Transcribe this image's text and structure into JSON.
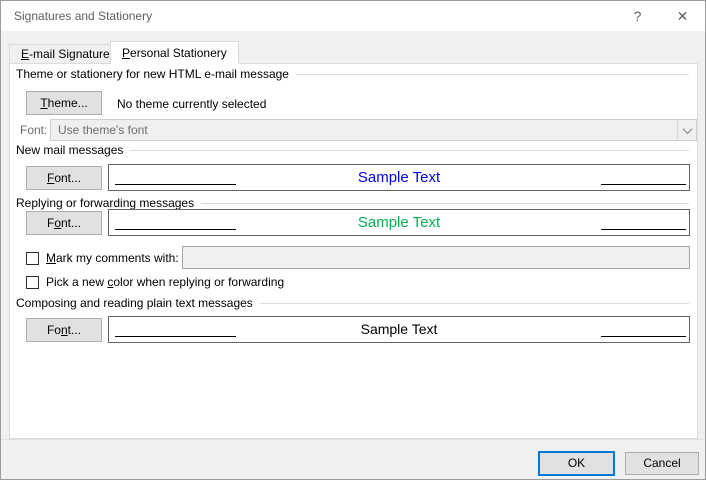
{
  "colors": {
    "accent": "#0078d7",
    "sample_new_mail": "#0000ff",
    "sample_reply_forward": "#00b050",
    "sample_plain_text": "#000000"
  },
  "window": {
    "title": "Signatures and Stationery",
    "help_glyph": "?",
    "close_glyph": "✕"
  },
  "tabs": {
    "email_signature": {
      "key": "E",
      "rest": "-mail Signature"
    },
    "personal_stationery": {
      "key": "P",
      "rest": "ersonal Stationery"
    }
  },
  "theme_section": {
    "heading": "Theme or stationery for new HTML e-mail message",
    "theme_button": {
      "pre": "",
      "key": "T",
      "rest": "heme..."
    },
    "status": "No theme currently selected",
    "font_label": "Font:",
    "font_value": "Use theme's font"
  },
  "new_mail": {
    "heading": "New mail messages",
    "font_button": {
      "pre": "",
      "key": "F",
      "rest": "ont..."
    },
    "sample": "Sample Text"
  },
  "reply_forward": {
    "heading": "Replying or forwarding messages",
    "font_button": {
      "pre": "F",
      "key": "o",
      "rest": "nt..."
    },
    "sample": "Sample Text",
    "mark_checkbox": {
      "pre": "",
      "key": "M",
      "rest": "ark my comments with:"
    },
    "mark_value": "",
    "pick_color_checkbox": {
      "pre": "Pick a new ",
      "key": "c",
      "rest": "olor when replying or forwarding"
    }
  },
  "plain_text": {
    "heading": "Composing and reading plain text messages",
    "font_button": {
      "pre": "Fo",
      "key": "n",
      "rest": "t..."
    },
    "sample": "Sample Text"
  },
  "footer": {
    "ok": "OK",
    "cancel": "Cancel"
  }
}
